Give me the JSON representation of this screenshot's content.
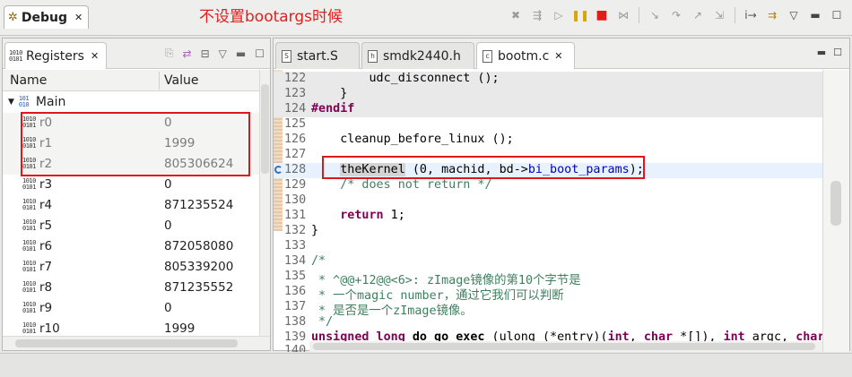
{
  "annotation_title": "不设置bootargs时候",
  "debug_view": {
    "tab_label": "Debug",
    "toolbar_icons": [
      "remove-terminated-icon",
      "connect-icon",
      "resume-icon",
      "suspend-icon",
      "terminate-icon",
      "disconnect-icon",
      "step-into-icon",
      "step-over-icon",
      "step-return-icon",
      "drop-to-frame-icon",
      "instruction-step-icon",
      "use-step-filters-icon",
      "view-menu-icon",
      "minimize-icon",
      "maximize-icon"
    ]
  },
  "registers_view": {
    "tab_label": "Registers",
    "columns": {
      "name": "Name",
      "value": "Value"
    },
    "group": "Main",
    "rows": [
      {
        "name": "r0",
        "value": "0",
        "muted": true
      },
      {
        "name": "r1",
        "value": "1999",
        "muted": true
      },
      {
        "name": "r2",
        "value": "805306624",
        "muted": true
      },
      {
        "name": "r3",
        "value": "0",
        "muted": false
      },
      {
        "name": "r4",
        "value": "871235524",
        "muted": false
      },
      {
        "name": "r5",
        "value": "0",
        "muted": false
      },
      {
        "name": "r6",
        "value": "872058080",
        "muted": false
      },
      {
        "name": "r7",
        "value": "805339200",
        "muted": false
      },
      {
        "name": "r8",
        "value": "871235552",
        "muted": false
      },
      {
        "name": "r9",
        "value": "0",
        "muted": false
      },
      {
        "name": "r10",
        "value": "1999",
        "muted": false
      }
    ]
  },
  "editor": {
    "tabs": [
      {
        "label": "start.S",
        "icon": "S",
        "active": false
      },
      {
        "label": "smdk2440.h",
        "icon": "h",
        "active": false
      },
      {
        "label": "bootm.c",
        "icon": "c",
        "active": true
      }
    ],
    "lines": {
      "122": {
        "num": "122",
        "text": "        udc_disconnect ();"
      },
      "123": {
        "num": "123",
        "text": "    }"
      },
      "124": {
        "num": "124",
        "text": "#endif"
      },
      "125": {
        "num": "125",
        "text": ""
      },
      "126": {
        "num": "126",
        "text": "    cleanup_before_linux ();"
      },
      "127": {
        "num": "127",
        "text": ""
      },
      "128": {
        "num": "128",
        "word": "theKernel",
        "args": " (0, machid, bd->",
        "member": "bi_boot_params",
        "tail": ");"
      },
      "129": {
        "num": "129",
        "text": "    /* does not return */"
      },
      "130": {
        "num": "130",
        "text": ""
      },
      "131": {
        "num": "131",
        "kw": "return",
        "rest": " 1;"
      },
      "132": {
        "num": "132",
        "text": "}"
      },
      "133": {
        "num": "133",
        "text": ""
      },
      "134": {
        "num": "134",
        "text": "/*"
      },
      "135": {
        "num": "135",
        "text": " * ^@@+12@@<6>: zImage镜像的第10个字节是"
      },
      "136": {
        "num": "136",
        "text": " * 一个magic number，通过它我们可以判断"
      },
      "137": {
        "num": "137",
        "text": " * 是否是一个zImage镜像。"
      },
      "138": {
        "num": "138",
        "text": " */"
      },
      "139": {
        "num": "139",
        "t1": "unsigned long",
        "t2": " ",
        "fn": "do_go_exec",
        "t3": " (ulong (*entry)(",
        "k1": "int",
        "t4": ", ",
        "k2": "char",
        "t5": " *[]), ",
        "k3": "int",
        "t6": " argc, ",
        "k4": "char"
      },
      "140": {
        "num": "140",
        "text": "{"
      }
    }
  }
}
